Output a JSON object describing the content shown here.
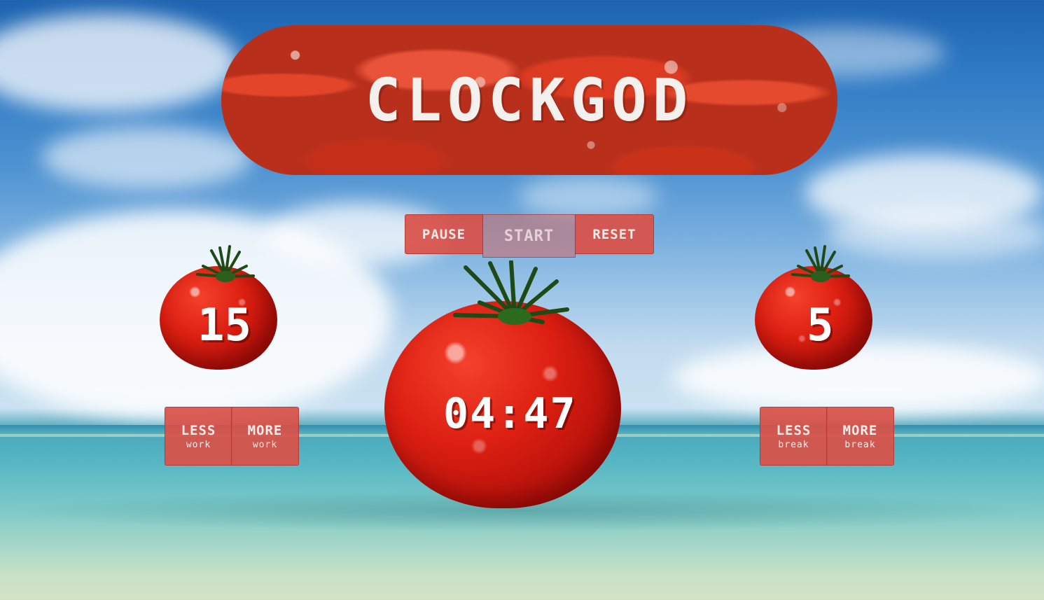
{
  "app": {
    "title": "CLOCKGOD"
  },
  "controls": {
    "pause_label": "PAUSE",
    "start_label": "START",
    "reset_label": "RESET"
  },
  "timer": {
    "display": "04:47"
  },
  "work": {
    "minutes": "15",
    "less_label": "LESS",
    "less_sub": "work",
    "more_label": "MORE",
    "more_sub": "work"
  },
  "break": {
    "minutes": "5",
    "less_label": "LESS",
    "less_sub": "break",
    "more_label": "MORE",
    "more_sub": "break"
  },
  "colors": {
    "button_bg": "#da5048",
    "tomato_red": "#dc1f12",
    "sky_blue": "#2f7ac4",
    "sea_turquoise": "#4aa8bd"
  },
  "icons": {
    "title_background": "tomatoes-photo",
    "timer_background": "tomato-icon"
  }
}
